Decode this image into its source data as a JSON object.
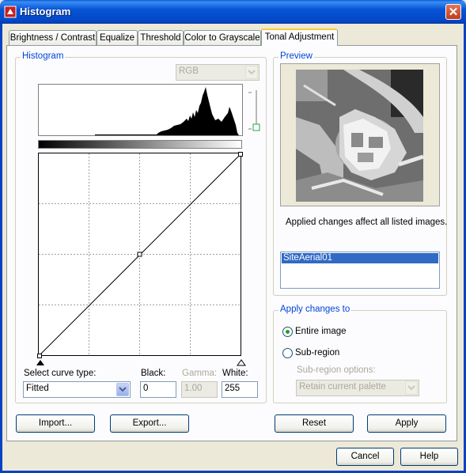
{
  "window": {
    "title": "Histogram",
    "close_glyph": "✕"
  },
  "tabs": [
    {
      "label": "Brightness / Contrast",
      "active": false
    },
    {
      "label": "Equalize",
      "active": false
    },
    {
      "label": "Threshold",
      "active": false
    },
    {
      "label": "Color to Grayscale",
      "active": false
    },
    {
      "label": "Tonal Adjustment",
      "active": true
    }
  ],
  "histogram": {
    "group_label": "Histogram",
    "channel_select": "RGB",
    "curve_type_label": "Select curve type:",
    "curve_type_value": "Fitted",
    "black_label": "Black:",
    "black_value": "0",
    "gamma_label": "Gamma:",
    "gamma_value": "1.00",
    "white_label": "White:",
    "white_value": "255"
  },
  "preview": {
    "group_label": "Preview",
    "note": "Applied changes affect all listed images.",
    "images": [
      "SiteAerial01"
    ]
  },
  "apply_changes": {
    "group_label": "Apply changes to",
    "entire_image_label": "Entire image",
    "entire_image_selected": true,
    "sub_region_label": "Sub-region",
    "sub_region_selected": false,
    "sub_region_options_label": "Sub-region options:",
    "sub_region_options_value": "Retain current palette"
  },
  "buttons": {
    "import": "Import...",
    "export": "Export...",
    "reset": "Reset",
    "apply": "Apply",
    "cancel": "Cancel",
    "help": "Help"
  },
  "colors": {
    "accent": "#0046d5",
    "titlebar": "#0654d6",
    "selection": "#316ac5"
  }
}
